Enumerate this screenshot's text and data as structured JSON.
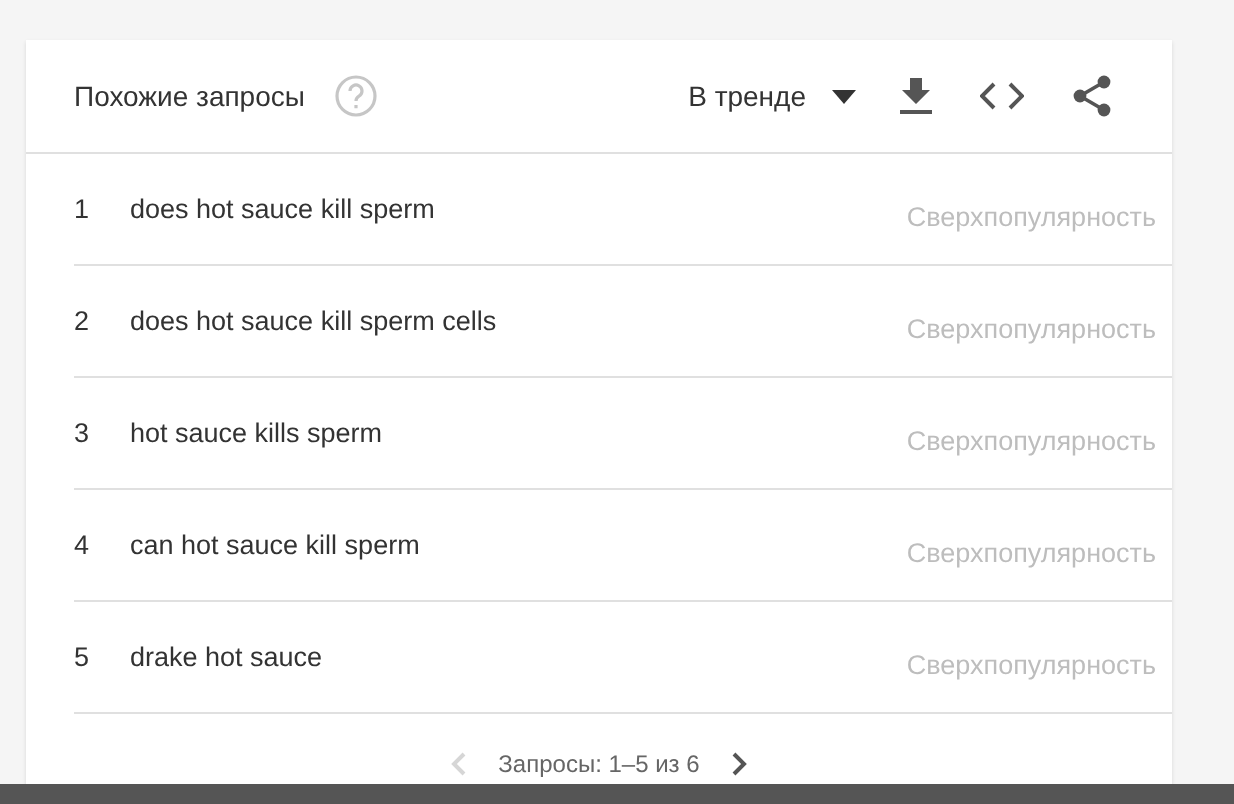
{
  "header": {
    "title": "Похожие запросы",
    "sort": "В тренде"
  },
  "rows": [
    {
      "rank": "1",
      "query": "does hot sauce kill sperm",
      "value": "Сверхпопулярность"
    },
    {
      "rank": "2",
      "query": "does hot sauce kill sperm cells",
      "value": "Сверхпопулярность"
    },
    {
      "rank": "3",
      "query": "hot sauce kills sperm",
      "value": "Сверхпопулярность"
    },
    {
      "rank": "4",
      "query": "can hot sauce kill sperm",
      "value": "Сверхпопулярность"
    },
    {
      "rank": "5",
      "query": "drake hot sauce",
      "value": "Сверхпопулярность"
    }
  ],
  "pagination": {
    "label": "Запросы: 1–5 из 6",
    "prev_disabled": true,
    "next_disabled": false
  }
}
